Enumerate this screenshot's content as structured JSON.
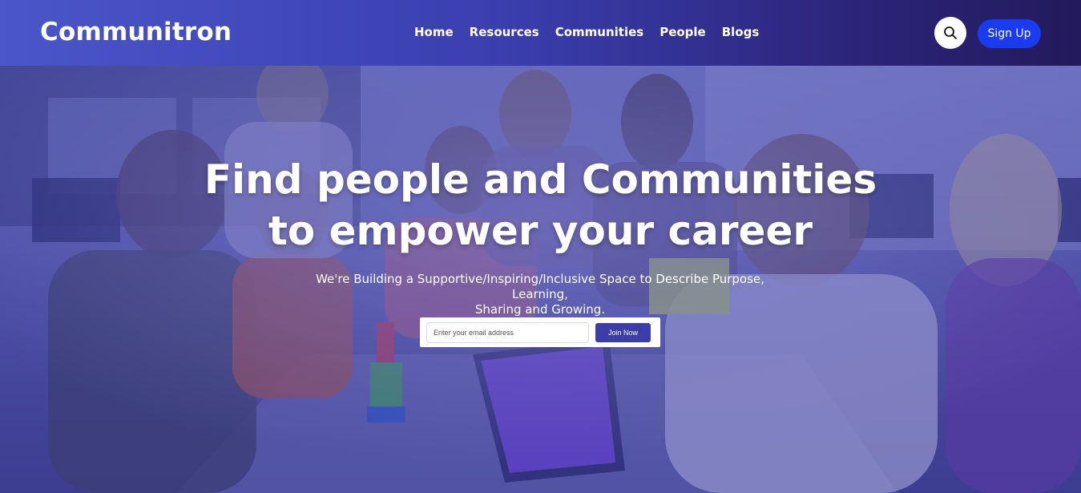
{
  "header": {
    "logo": "Communitron",
    "nav": [
      "Home",
      "Resources",
      "Communities",
      "People",
      "Blogs"
    ],
    "signup_label": "Sign Up",
    "search_icon": "search-icon"
  },
  "hero": {
    "title_line1": "Find people and Communities",
    "title_line2": "to empower your career",
    "subtitle_line1": "We're Building a Supportive/Inspiring/Inclusive Space to Describe Purpose, Learning,",
    "subtitle_line2": "Sharing and Growing.",
    "email_placeholder": "Enter your email address",
    "join_label": "Join Now"
  },
  "colors": {
    "header_start": "#4a56c9",
    "header_end": "#231a5c",
    "signup_button": "#1a3cf0",
    "join_button": "#3b3ea8",
    "overlay": "#3c3caa"
  }
}
